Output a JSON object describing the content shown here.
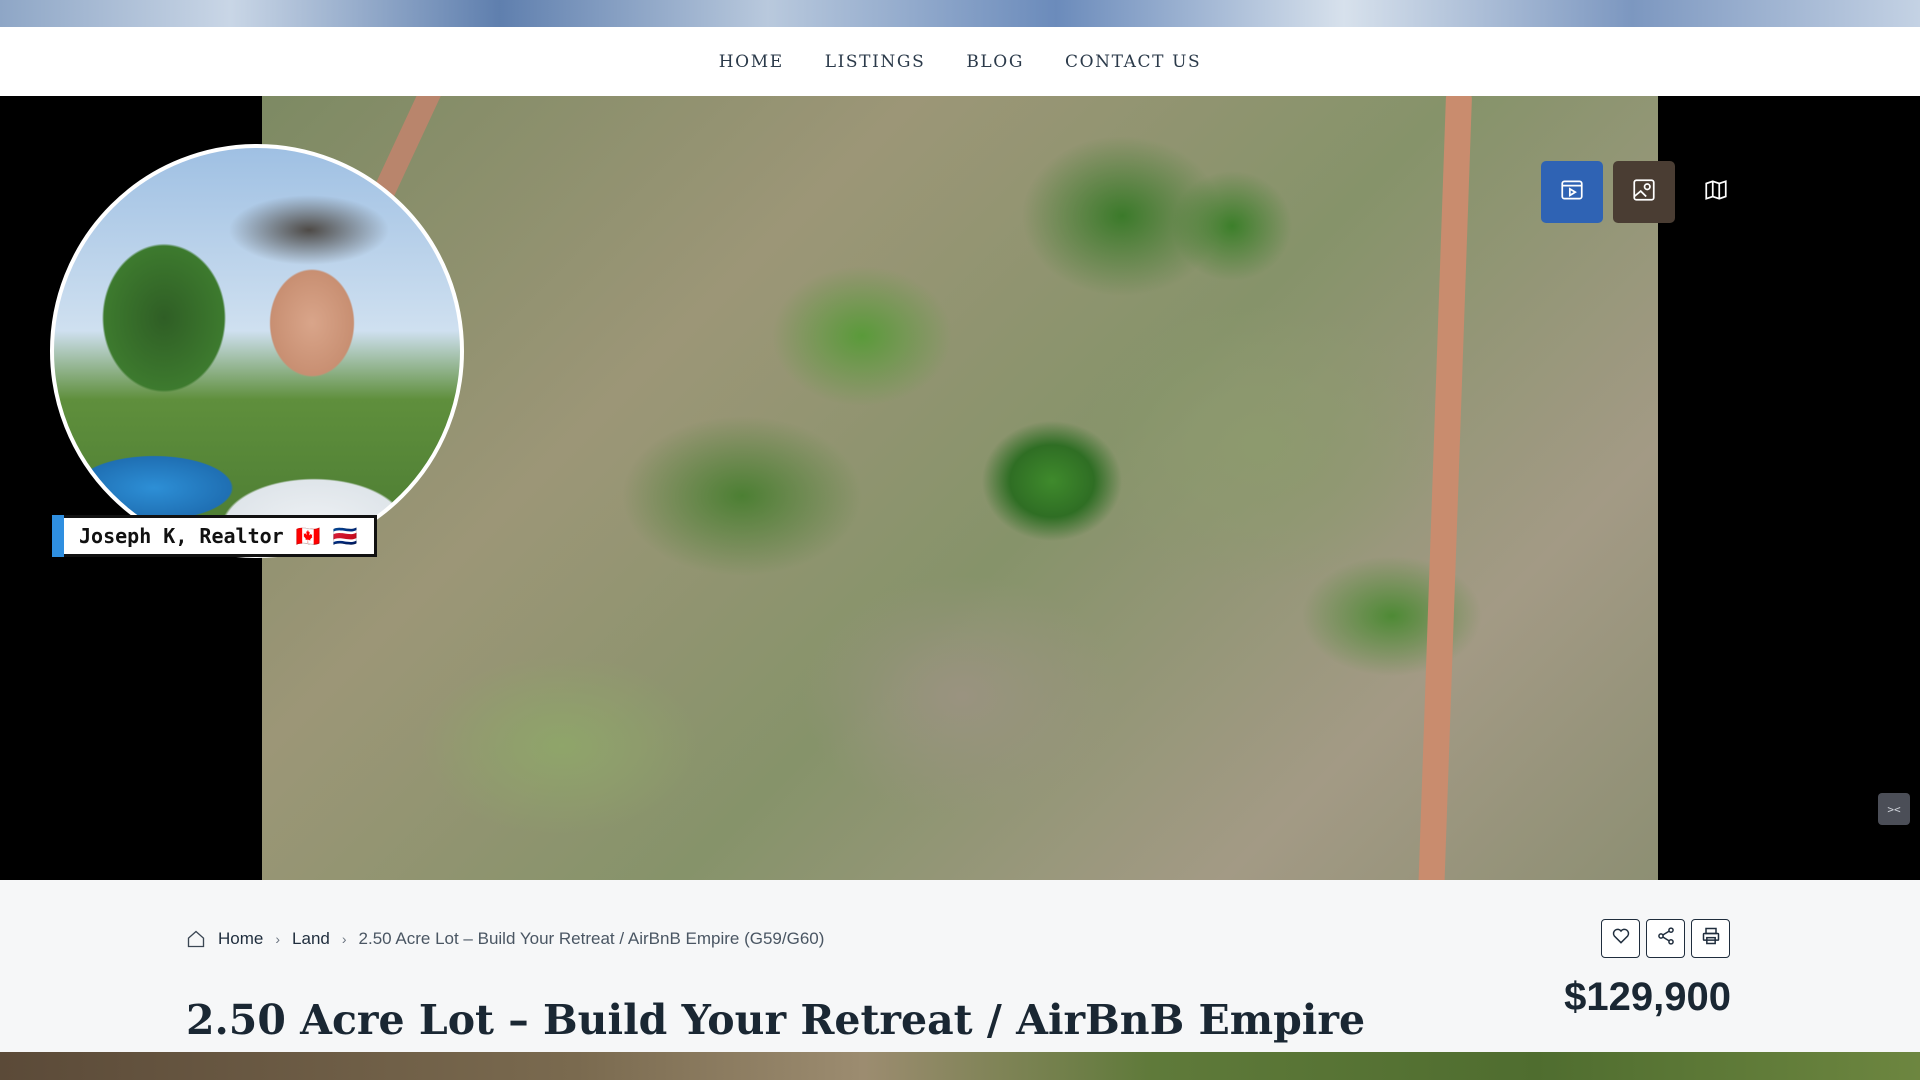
{
  "nav": {
    "items": [
      {
        "label": "HOME"
      },
      {
        "label": "LISTINGS"
      },
      {
        "label": "BLOG"
      },
      {
        "label": "CONTACT US"
      }
    ]
  },
  "hero": {
    "media_tabs": [
      {
        "icon": "video-icon",
        "active": true
      },
      {
        "icon": "photo-icon",
        "active": false
      },
      {
        "icon": "map-icon",
        "active": false
      }
    ],
    "presenter_label": "Joseph K, Realtor 🇨🇦 🇨🇷"
  },
  "breadcrumb": {
    "home": "Home",
    "category": "Land",
    "current": "2.50 Acre Lot – Build Your Retreat / AirBnB Empire (G59/G60)"
  },
  "listing": {
    "title": "2.50 Acre Lot – Build Your Retreat / AirBnB Empire",
    "price": "$129,900"
  },
  "actions": [
    "heart-icon",
    "share-icon",
    "print-icon"
  ],
  "colors": {
    "accent": "#2f63b4",
    "text_dark": "#1a2733",
    "label_bar": "#2f8fe0"
  }
}
